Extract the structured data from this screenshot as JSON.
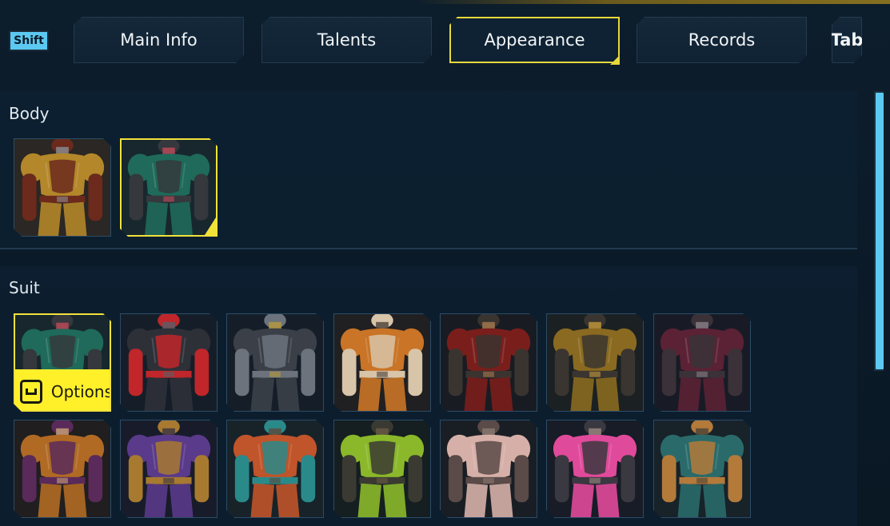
{
  "hints": {
    "prev_key": "Shift",
    "next_key": "Tab"
  },
  "tabs": [
    {
      "label": "Main Info",
      "active": false
    },
    {
      "label": "Talents",
      "active": false
    },
    {
      "label": "Appearance",
      "active": true
    },
    {
      "label": "Records",
      "active": false
    }
  ],
  "sections": {
    "body": {
      "title": "Body"
    },
    "suit": {
      "title": "Suit",
      "options_label": "Options",
      "options_key_icon": "space-key-icon"
    }
  },
  "colors": {
    "accent_yellow": "#f1e23a",
    "accent_cyan": "#5cc9f2",
    "background": "#0b1a28"
  }
}
